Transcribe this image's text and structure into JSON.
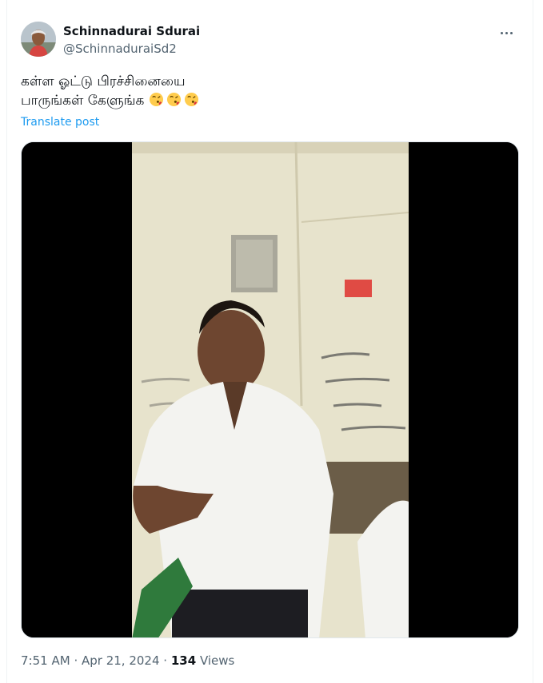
{
  "author": {
    "name": "Schinnadurai Sdurai",
    "handle": "@SchinnaduraiSd2"
  },
  "tweet": {
    "text_line1": "கள்ள ஓட்டு பிரச்சினையை",
    "text_line2": "பாருங்கள் கேளுங்க",
    "emoji_icons": [
      "face-blowing-kiss",
      "face-blowing-kiss",
      "face-blowing-kiss"
    ],
    "translate_label": "Translate post"
  },
  "media": {
    "type": "video",
    "background": "#000000"
  },
  "meta": {
    "time": "7:51 AM",
    "separator": "·",
    "date": "Apr 21, 2024",
    "views_count": "134",
    "views_label": "Views"
  },
  "colors": {
    "link": "#1d9bf0",
    "secondary_text": "#536471",
    "primary_text": "#0f1419"
  }
}
